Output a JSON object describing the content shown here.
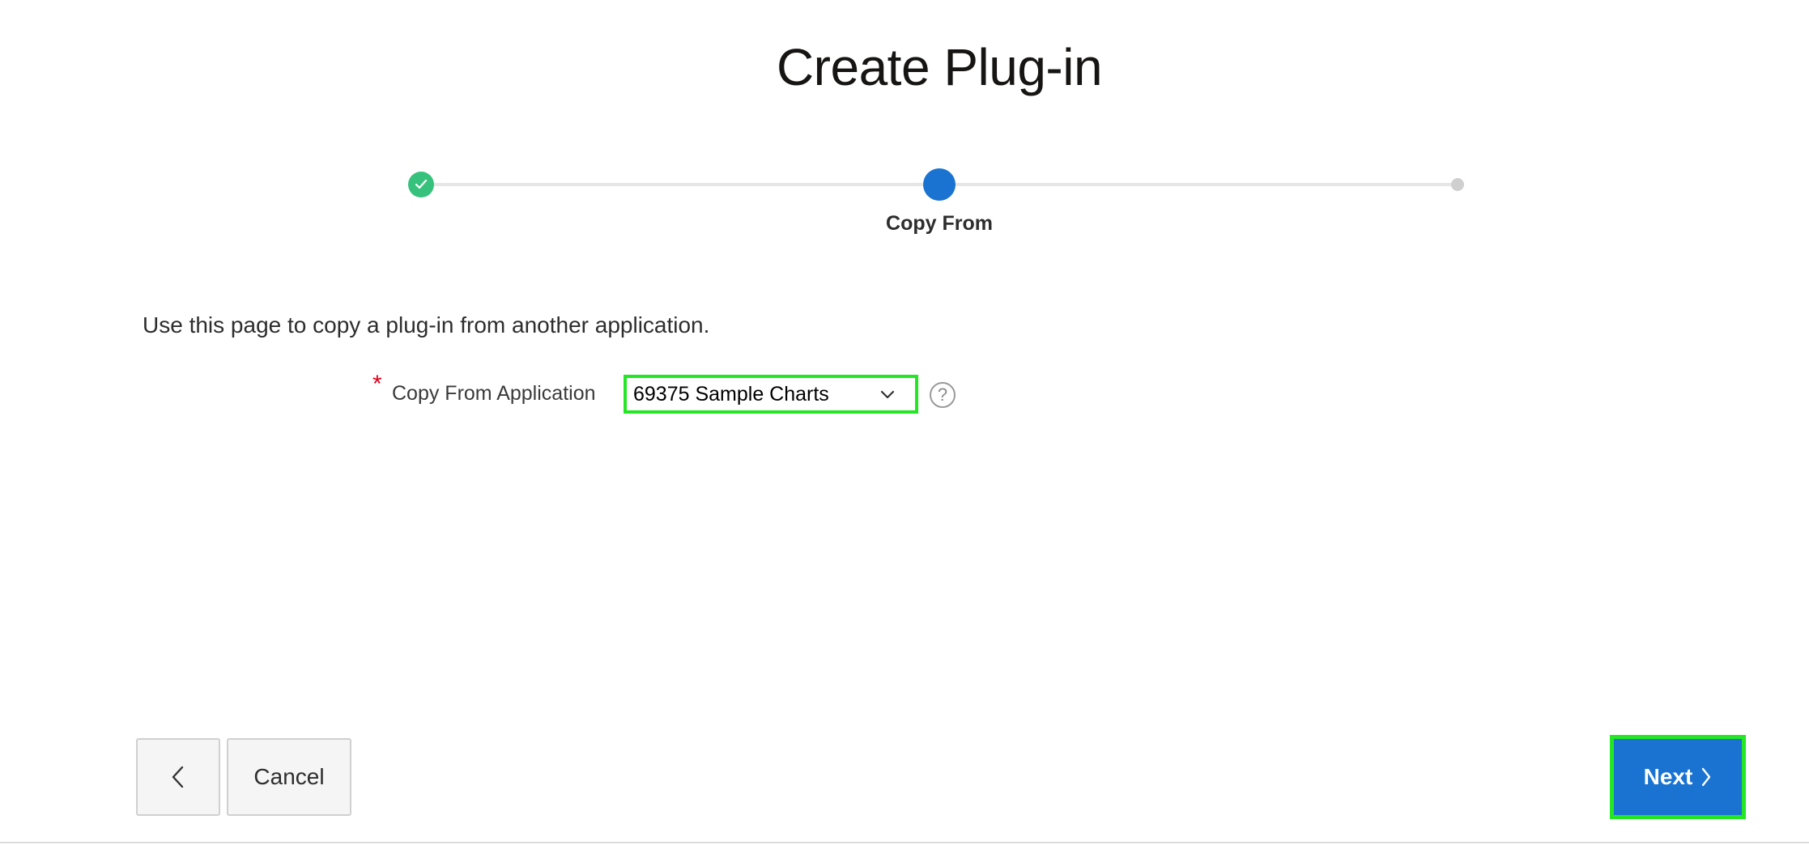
{
  "page": {
    "title": "Create Plug-in",
    "intro": "Use this page to copy a plug-in from another application."
  },
  "wizard": {
    "steps": [
      {
        "state": "complete",
        "icon": "check-icon"
      },
      {
        "state": "current",
        "label": "Copy From"
      },
      {
        "state": "future"
      }
    ]
  },
  "form": {
    "copy_from_application": {
      "label": "Copy From Application",
      "required_marker": "*",
      "value": "69375 Sample Charts",
      "help_glyph": "?"
    }
  },
  "footer": {
    "cancel_label": "Cancel",
    "next_label": "Next"
  },
  "colors": {
    "accent": "#1a73d1",
    "complete": "#36c27c",
    "highlight": "#25e625",
    "required": "#e0001b"
  }
}
